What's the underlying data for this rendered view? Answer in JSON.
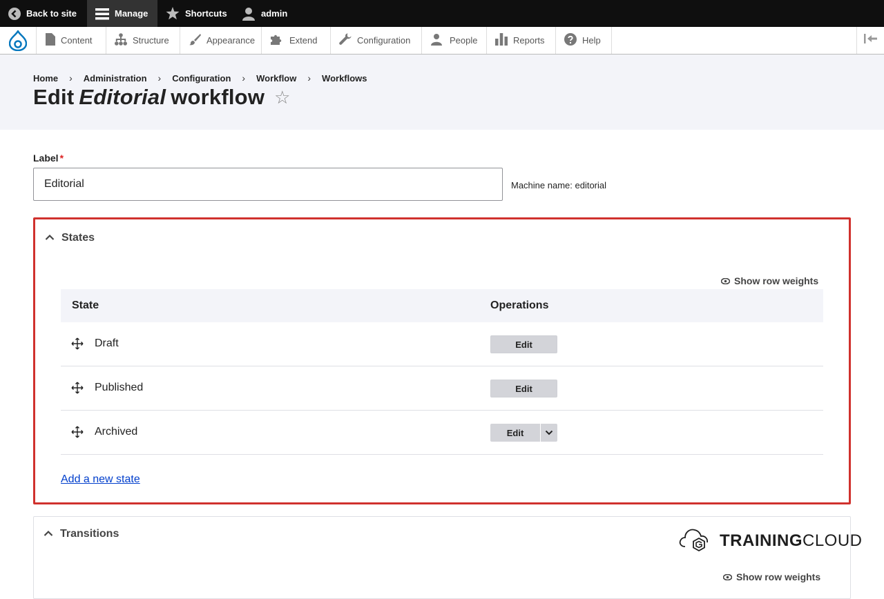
{
  "toolbar": {
    "back_to_site": "Back to site",
    "manage": "Manage",
    "shortcuts": "Shortcuts",
    "user": "admin"
  },
  "tray": {
    "items": [
      "Content",
      "Structure",
      "Appearance",
      "Extend",
      "Configuration",
      "People",
      "Reports",
      "Help"
    ]
  },
  "breadcrumb": [
    "Home",
    "Administration",
    "Configuration",
    "Workflow",
    "Workflows"
  ],
  "title": {
    "prefix": "Edit",
    "name": "Editorial",
    "suffix": "workflow"
  },
  "form": {
    "label_title": "Label",
    "label_value": "Editorial",
    "machine_name": "Machine name: editorial"
  },
  "states": {
    "summary": "States",
    "show_weights": "Show row weights",
    "col_state": "State",
    "col_operations": "Operations",
    "rows": [
      {
        "name": "Draft",
        "op": "Edit"
      },
      {
        "name": "Published",
        "op": "Edit"
      },
      {
        "name": "Archived",
        "op": "Edit"
      }
    ],
    "add_link": "Add a new state"
  },
  "transitions": {
    "summary": "Transitions",
    "show_weights": "Show row weights"
  },
  "watermark": {
    "bold": "TRAINING",
    "light": "CLOUD"
  },
  "colors": {
    "highlight": "#d0312d",
    "link": "#003ecc",
    "toolbar": "#0f0f0f"
  }
}
